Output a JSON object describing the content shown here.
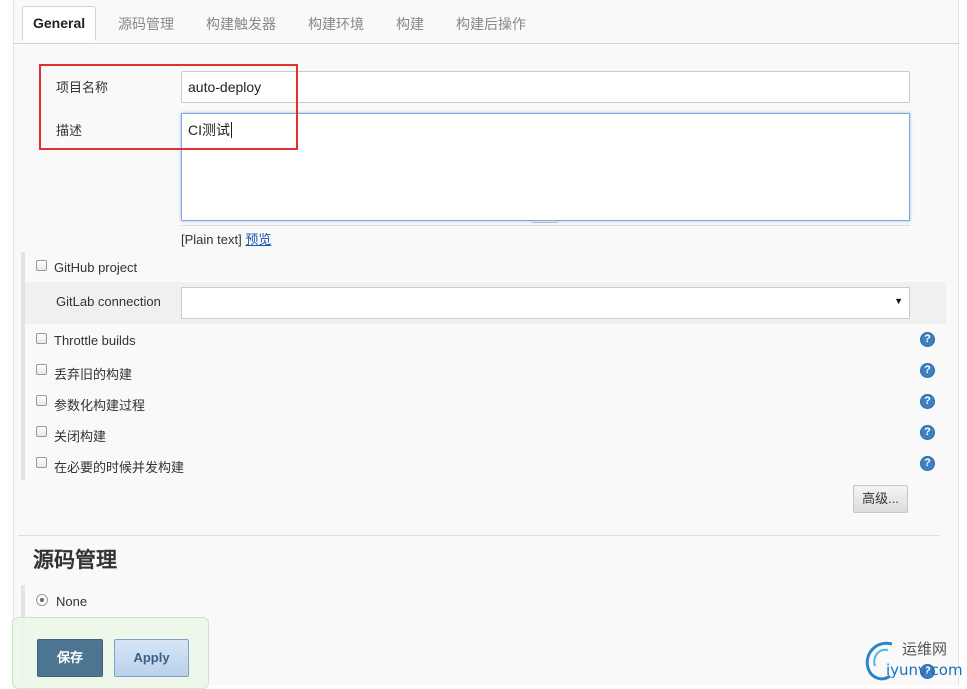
{
  "tabs": [
    "General",
    "源码管理",
    "构建触发器",
    "构建环境",
    "构建",
    "构建后操作"
  ],
  "general": {
    "project_name_label": "项目名称",
    "project_name_value": "auto-deploy",
    "description_label": "描述",
    "description_value": "CI测试",
    "plain_text": "[Plain text]",
    "preview_link": "预览",
    "github_project_label": "GitHub project",
    "gitlab_connection_label": "GitLab connection",
    "gitlab_connection_value": "",
    "options": [
      {
        "label": "Throttle builds"
      },
      {
        "label": "丢弃旧的构建"
      },
      {
        "label": "参数化构建过程"
      },
      {
        "label": "关闭构建"
      },
      {
        "label": "在必要的时候并发构建"
      }
    ],
    "advanced_button": "高级..."
  },
  "scm": {
    "title": "源码管理",
    "none_label": "None"
  },
  "footer": {
    "save_label": "保存",
    "apply_label": "Apply"
  },
  "watermark": {
    "line1": "运维网",
    "line2": "iyunv.com"
  },
  "colors": {
    "highlight_box": "#e03030",
    "save_button": "#4b7590",
    "help_icon": "#3d7fbf"
  }
}
